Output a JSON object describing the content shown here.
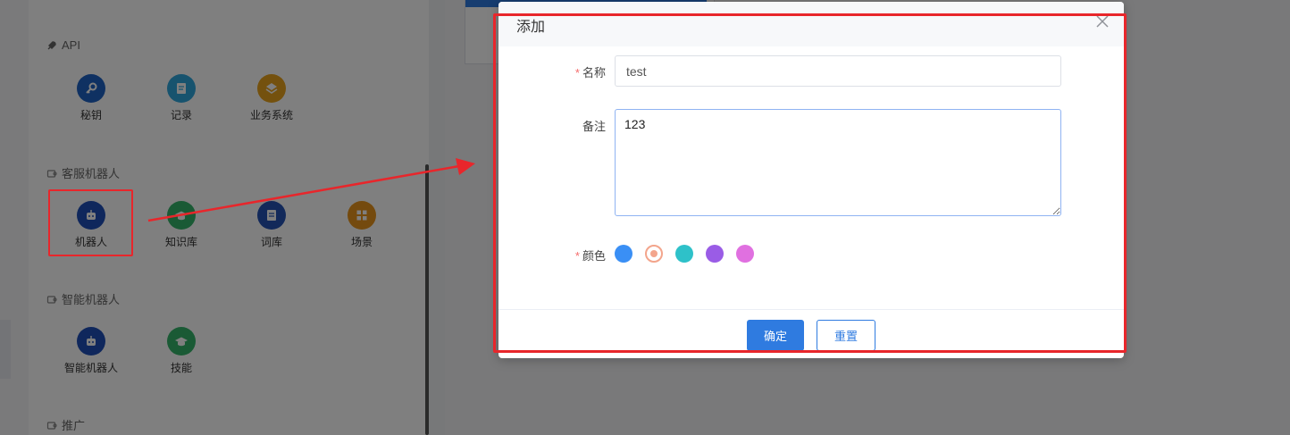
{
  "background": {
    "card_banner_text": "",
    "sections": [
      {
        "title": "API",
        "icon": "rocket-icon",
        "items": [
          {
            "label": "秘钥",
            "icon": "key-icon",
            "color": "#1e63c4"
          },
          {
            "label": "记录",
            "icon": "document-icon",
            "color": "#2fa6dd"
          },
          {
            "label": "业务系统",
            "icon": "layers-icon",
            "color": "#e8a21c"
          }
        ]
      },
      {
        "title": "客服机器人",
        "icon": "puzzle-icon",
        "items": [
          {
            "label": "机器人",
            "icon": "robot-icon",
            "color": "#1e4fb8"
          },
          {
            "label": "知识库",
            "icon": "graduation-cap-icon",
            "color": "#35b46b"
          },
          {
            "label": "词库",
            "icon": "book-icon",
            "color": "#2453b5"
          },
          {
            "label": "场景",
            "icon": "grid-icon",
            "color": "#e8951c"
          }
        ]
      },
      {
        "title": "智能机器人",
        "icon": "puzzle-icon",
        "items": [
          {
            "label": "智能机器人",
            "icon": "robot-icon",
            "color": "#1e4fb8"
          },
          {
            "label": "技能",
            "icon": "graduation-cap-icon",
            "color": "#35b46b"
          }
        ]
      },
      {
        "title": "推广",
        "icon": "puzzle-icon",
        "items": []
      }
    ]
  },
  "dialog": {
    "title": "添加",
    "fields": {
      "name": {
        "label": "名称",
        "required": "*",
        "value": "test"
      },
      "remark": {
        "label": "备注",
        "value": "123"
      },
      "color": {
        "label": "颜色",
        "required": "*",
        "options": [
          "#3a8ff5",
          "#f3a58c",
          "#2ec1c9",
          "#9a5ce6",
          "#e070e0"
        ],
        "selected_index": 1
      }
    },
    "confirm_label": "确定",
    "reset_label": "重置"
  }
}
